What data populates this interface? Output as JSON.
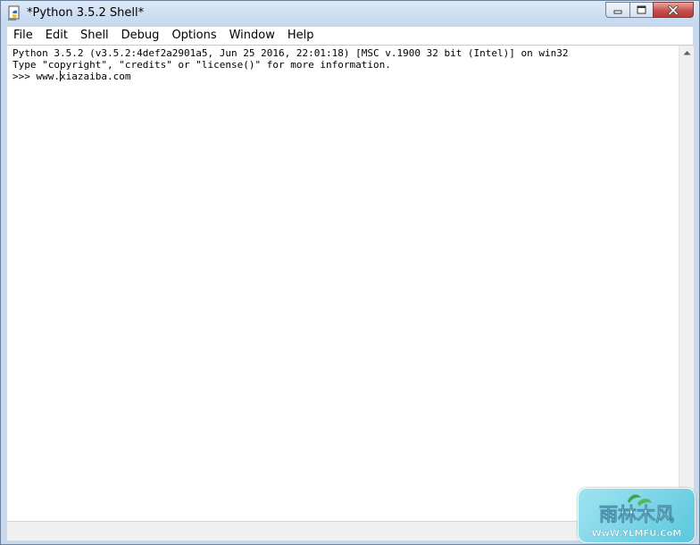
{
  "window": {
    "title": "*Python 3.5.2 Shell*"
  },
  "menu": {
    "items": [
      "File",
      "Edit",
      "Shell",
      "Debug",
      "Options",
      "Window",
      "Help"
    ]
  },
  "shell": {
    "lines": [
      "Python 3.5.2 (v3.5.2:4def2a2901a5, Jun 25 2016, 22:01:18) [MSC v.1900 32 bit (Intel)] on win32",
      "Type \"copyright\", \"credits\" or \"license()\" for more information."
    ],
    "prompt": ">>> ",
    "input_before_caret": "www.",
    "input_after_caret": "xiazaiba.com"
  },
  "icons": {
    "app": "python-idle-icon",
    "minimize": "minimize-icon",
    "maximize": "maximize-icon",
    "close": "close-icon",
    "scroll_up": "scroll-up-arrow-icon"
  },
  "watermark": {
    "brand": "雨林木风",
    "url": "WwW.YLMFU.CoM"
  },
  "colors": {
    "title_bg": "#c4d7ee",
    "close_red": "#c75050",
    "text": "#000000",
    "watermark": "#5bc7de"
  }
}
